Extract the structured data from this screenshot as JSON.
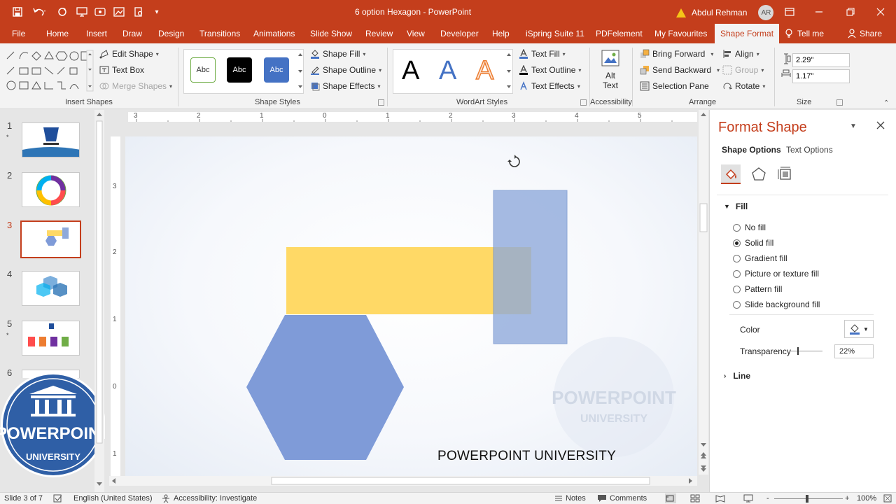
{
  "titlebar": {
    "document_title": "6 option Hexagon  -  PowerPoint",
    "user_name": "Abdul Rehman",
    "user_initials": "AR"
  },
  "tabs": [
    "File",
    "Home",
    "Insert",
    "Draw",
    "Design",
    "Transitions",
    "Animations",
    "Slide Show",
    "Review",
    "View",
    "Developer",
    "Help",
    "iSpring Suite 11",
    "PDFelement",
    "My Favourites",
    "Shape Format",
    "Tell me",
    "Share"
  ],
  "ribbon": {
    "insert_shapes": {
      "label": "Insert Shapes",
      "edit_shape": "Edit Shape",
      "text_box": "Text Box",
      "merge_shapes": "Merge Shapes"
    },
    "shape_styles": {
      "label": "Shape Styles",
      "preset": "Abc",
      "shape_fill": "Shape Fill",
      "shape_outline": "Shape Outline",
      "shape_effects": "Shape Effects"
    },
    "wordart_styles": {
      "label": "WordArt Styles",
      "letter": "A",
      "text_fill": "Text Fill",
      "text_outline": "Text Outline",
      "text_effects": "Text Effects"
    },
    "accessibility": {
      "label": "Accessibility",
      "alt_text_1": "Alt",
      "alt_text_2": "Text"
    },
    "arrange": {
      "label": "Arrange",
      "bring_forward": "Bring Forward",
      "send_backward": "Send Backward",
      "selection_pane": "Selection Pane",
      "align": "Align",
      "group": "Group",
      "rotate": "Rotate"
    },
    "size": {
      "label": "Size",
      "height": "2.29\"",
      "width": "1.17\""
    }
  },
  "slides": {
    "numbers": [
      "1",
      "2",
      "3",
      "4",
      "5",
      "6"
    ],
    "star": "*",
    "selected": 3
  },
  "ruler": {
    "h_ticks": [
      "3",
      "2",
      "1",
      "0",
      "1",
      "2",
      "3",
      "4",
      "5"
    ],
    "v_ticks": [
      "3",
      "2",
      "1",
      "0",
      "1"
    ]
  },
  "slide": {
    "text": "POWERPOINT UNIVERSITY",
    "shapes": {
      "rectangle_yellow_color": "#FFD966",
      "rectangle_blue_color": "#8EA9DB",
      "hexagon_color": "#7F9BD8"
    }
  },
  "logo": {
    "line1": "POWERPOINT",
    "line2": "UNIVERSITY"
  },
  "watermark": {
    "line1": "POWERPOINT",
    "line2": "UNIVERSITY"
  },
  "pane": {
    "title": "Format Shape",
    "tab_shape_options": "Shape Options",
    "tab_text_options": "Text Options",
    "fill_header": "Fill",
    "fill_options": [
      "No fill",
      "Solid fill",
      "Gradient fill",
      "Picture or texture fill",
      "Pattern fill",
      "Slide background fill"
    ],
    "selected_fill": "Solid fill",
    "color_label": "Color",
    "color_value": "#4472C4",
    "transparency_label": "Transparency",
    "transparency_value": "22%",
    "transparency_fraction": 0.22,
    "line_header": "Line"
  },
  "status": {
    "slide_counter": "Slide 3 of 7",
    "language": "English (United States)",
    "accessibility": "Accessibility: Investigate",
    "notes": "Notes",
    "comments": "Comments",
    "zoom": "100%",
    "zoom_minus": "-",
    "zoom_plus": "+"
  }
}
